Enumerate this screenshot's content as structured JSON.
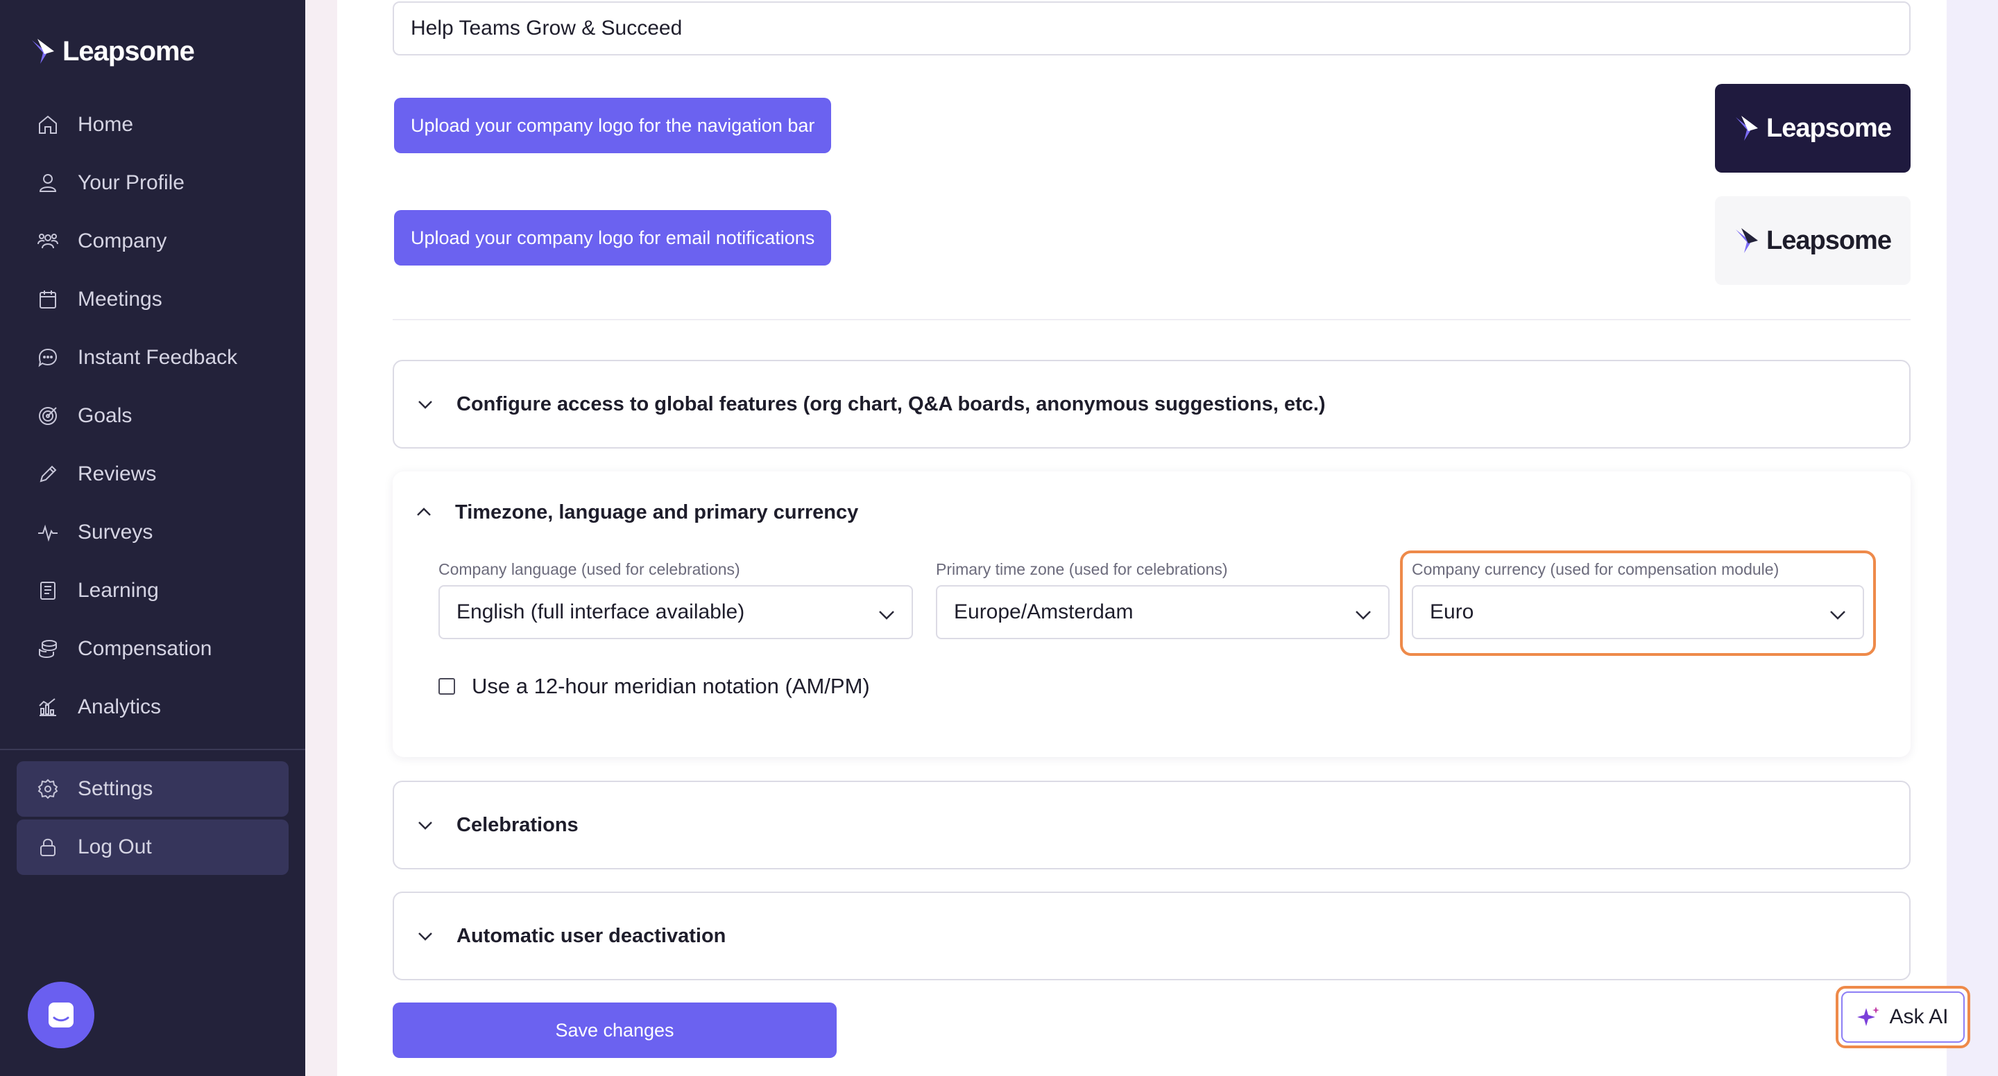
{
  "brand": {
    "name": "Leapsome"
  },
  "sidebar": {
    "items": [
      {
        "label": "Home",
        "icon": "home-icon"
      },
      {
        "label": "Your Profile",
        "icon": "user-icon"
      },
      {
        "label": "Company",
        "icon": "people-icon"
      },
      {
        "label": "Meetings",
        "icon": "calendar-icon"
      },
      {
        "label": "Instant Feedback",
        "icon": "chat-icon"
      },
      {
        "label": "Goals",
        "icon": "target-icon"
      },
      {
        "label": "Reviews",
        "icon": "pencil-icon"
      },
      {
        "label": "Surveys",
        "icon": "pulse-icon"
      },
      {
        "label": "Learning",
        "icon": "book-icon"
      },
      {
        "label": "Compensation",
        "icon": "coins-icon"
      },
      {
        "label": "Analytics",
        "icon": "chart-icon"
      }
    ],
    "bottom": [
      {
        "label": "Settings",
        "icon": "gear-icon"
      },
      {
        "label": "Log Out",
        "icon": "lock-icon"
      }
    ]
  },
  "form": {
    "mission_value": "Help Teams Grow & Succeed",
    "upload_nav_label": "Upload your company logo for the navigation bar",
    "upload_email_label": "Upload your company logo for email notifications",
    "logo_text": "Leapsome"
  },
  "sections": {
    "global_features": "Configure access to global features (org chart, Q&A boards, anonymous suggestions, etc.)",
    "timezone": {
      "title": "Timezone, language and primary currency",
      "language_label": "Company language (used for celebrations)",
      "language_value": "English (full interface available)",
      "timezone_label": "Primary time zone (used for celebrations)",
      "timezone_value": "Europe/Amsterdam",
      "currency_label": "Company currency (used for compensation module)",
      "currency_value": "Euro",
      "meridian_label": "Use a 12-hour meridian notation (AM/PM)",
      "meridian_checked": false
    },
    "celebrations": "Celebrations",
    "deactivation": "Automatic user deactivation"
  },
  "actions": {
    "save_label": "Save changes",
    "ask_ai_label": "Ask AI"
  },
  "colors": {
    "sidebar_bg": "#23223a",
    "accent": "#6b62f0",
    "highlight": "#ee8a4a"
  }
}
